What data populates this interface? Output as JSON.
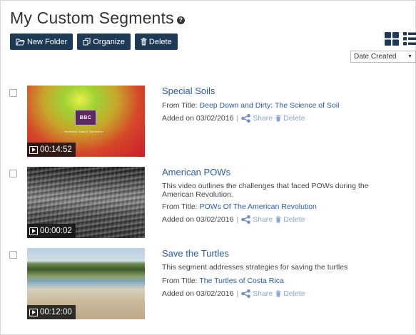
{
  "page": {
    "title": "My Custom Segments"
  },
  "toolbar": {
    "new_folder": "New Folder",
    "organize": "Organize",
    "delete": "Delete"
  },
  "sort": {
    "selected": "Date Created"
  },
  "segments": [
    {
      "title": "Special Soils",
      "description": "",
      "from_label": "From Title:",
      "from_title": "Deep Down and Dirty: The Science of Soil",
      "added": "Added on 03/02/2016",
      "share": "Share",
      "delete": "Delete",
      "duration": "00:14:52",
      "thumb_logo": "BBC",
      "thumb_caption": "Worldwide Sales & Distribution"
    },
    {
      "title": "American POWs",
      "description": "This video outlines the challenges that faced POWs during the American Revolution.",
      "from_label": "From Title:",
      "from_title": "POWs Of The American Revolution",
      "added": "Added on 03/02/2016",
      "share": "Share",
      "delete": "Delete",
      "duration": "00:00:02"
    },
    {
      "title": "Save the Turtles",
      "description": "This segment addresses strategies for saving the turtles",
      "from_label": "From Title:",
      "from_title": "The Turtles of Costa Rica",
      "added": "Added on 03/02/2016",
      "share": "Share",
      "delete": "Delete",
      "duration": "00:12:00"
    }
  ],
  "colors": {
    "button_bg": "#1f3a56",
    "link": "#2a5ba8",
    "action_link": "#8aa6d6"
  }
}
